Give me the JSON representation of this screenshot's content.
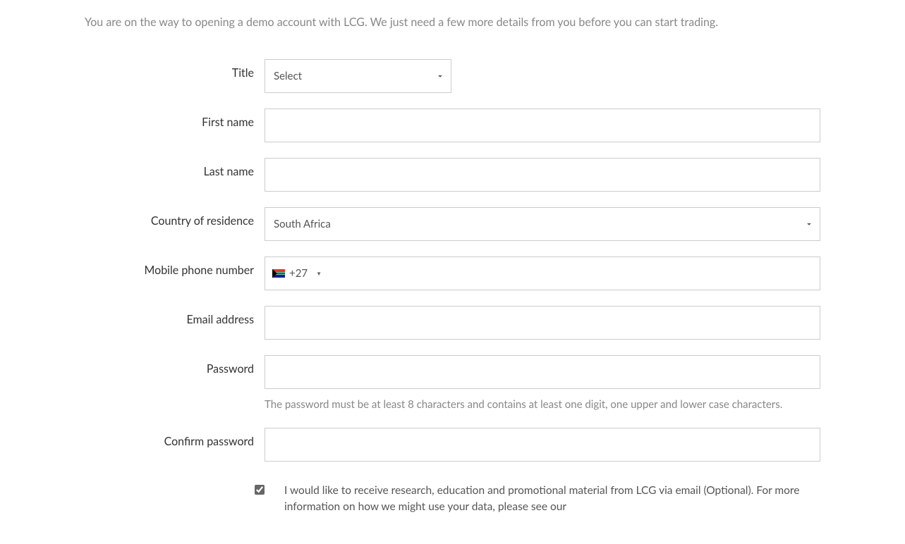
{
  "intro": "You are on the way to opening a demo account with LCG. We just need a few more details from you before you can start trading.",
  "fields": {
    "title": {
      "label": "Title",
      "selected": "Select"
    },
    "first_name": {
      "label": "First name",
      "value": ""
    },
    "last_name": {
      "label": "Last name",
      "value": ""
    },
    "country": {
      "label": "Country of residence",
      "selected": "South Africa"
    },
    "phone": {
      "label": "Mobile phone number",
      "dial_code": "+27",
      "flag": "south-africa",
      "value": ""
    },
    "email": {
      "label": "Email address",
      "value": ""
    },
    "password": {
      "label": "Password",
      "value": "",
      "help": "The password must be at least 8 characters and contains at least one digit, one upper and lower case characters."
    },
    "confirm_password": {
      "label": "Confirm password",
      "value": ""
    }
  },
  "marketing_consent": {
    "checked": true,
    "text": "I would like to receive research, education and promotional material from LCG via email (Optional). For more information on how we might use your data, please see our"
  }
}
